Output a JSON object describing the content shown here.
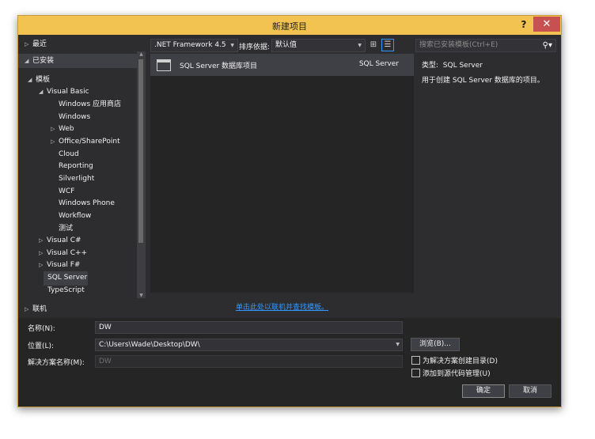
{
  "dialog": {
    "title": "新建项目",
    "help_label": "?",
    "close_label": "✕"
  },
  "tree": {
    "recent": "最近",
    "installed": "已安装",
    "templates": "模板",
    "visual_basic": "Visual Basic",
    "vb_children": [
      "Windows 应用商店",
      "Windows",
      "Web",
      "Office/SharePoint",
      "Cloud",
      "Reporting",
      "Silverlight",
      "WCF",
      "Windows Phone",
      "Workflow",
      "测试"
    ],
    "visual_csharp": "Visual C#",
    "visual_cpp": "Visual C++",
    "visual_fsharp": "Visual F#",
    "sql_server": "SQL Server",
    "typescript": "TypeScript",
    "online": "联机"
  },
  "toolbar": {
    "framework": ".NET Framework 4.5",
    "sort_label": "排序依据:",
    "sort_value": "默认值",
    "view_grid_icon": "⊞",
    "view_list_icon": "☰"
  },
  "search": {
    "placeholder": "搜索已安装模板(Ctrl+E)",
    "icon": "search-icon"
  },
  "templates": [
    {
      "name": "SQL Server 数据库项目",
      "language": "SQL Server"
    }
  ],
  "online_link": "单击此处以联机并查找模板。",
  "details": {
    "type_label": "类型:",
    "type_value": "SQL Server",
    "description": "用于创建 SQL Server 数据库的项目。"
  },
  "form": {
    "name_label": "名称(N):",
    "name_value": "DW",
    "location_label": "位置(L):",
    "location_value": "C:\\Users\\Wade\\Desktop\\DW\\",
    "solution_label": "解决方案名称(M):",
    "solution_value": "DW",
    "browse": "浏览(B)...",
    "create_dir": "为解决方案创建目录(D)",
    "add_source_control": "添加到源代码管理(U)",
    "ok": "确定",
    "cancel": "取消"
  }
}
